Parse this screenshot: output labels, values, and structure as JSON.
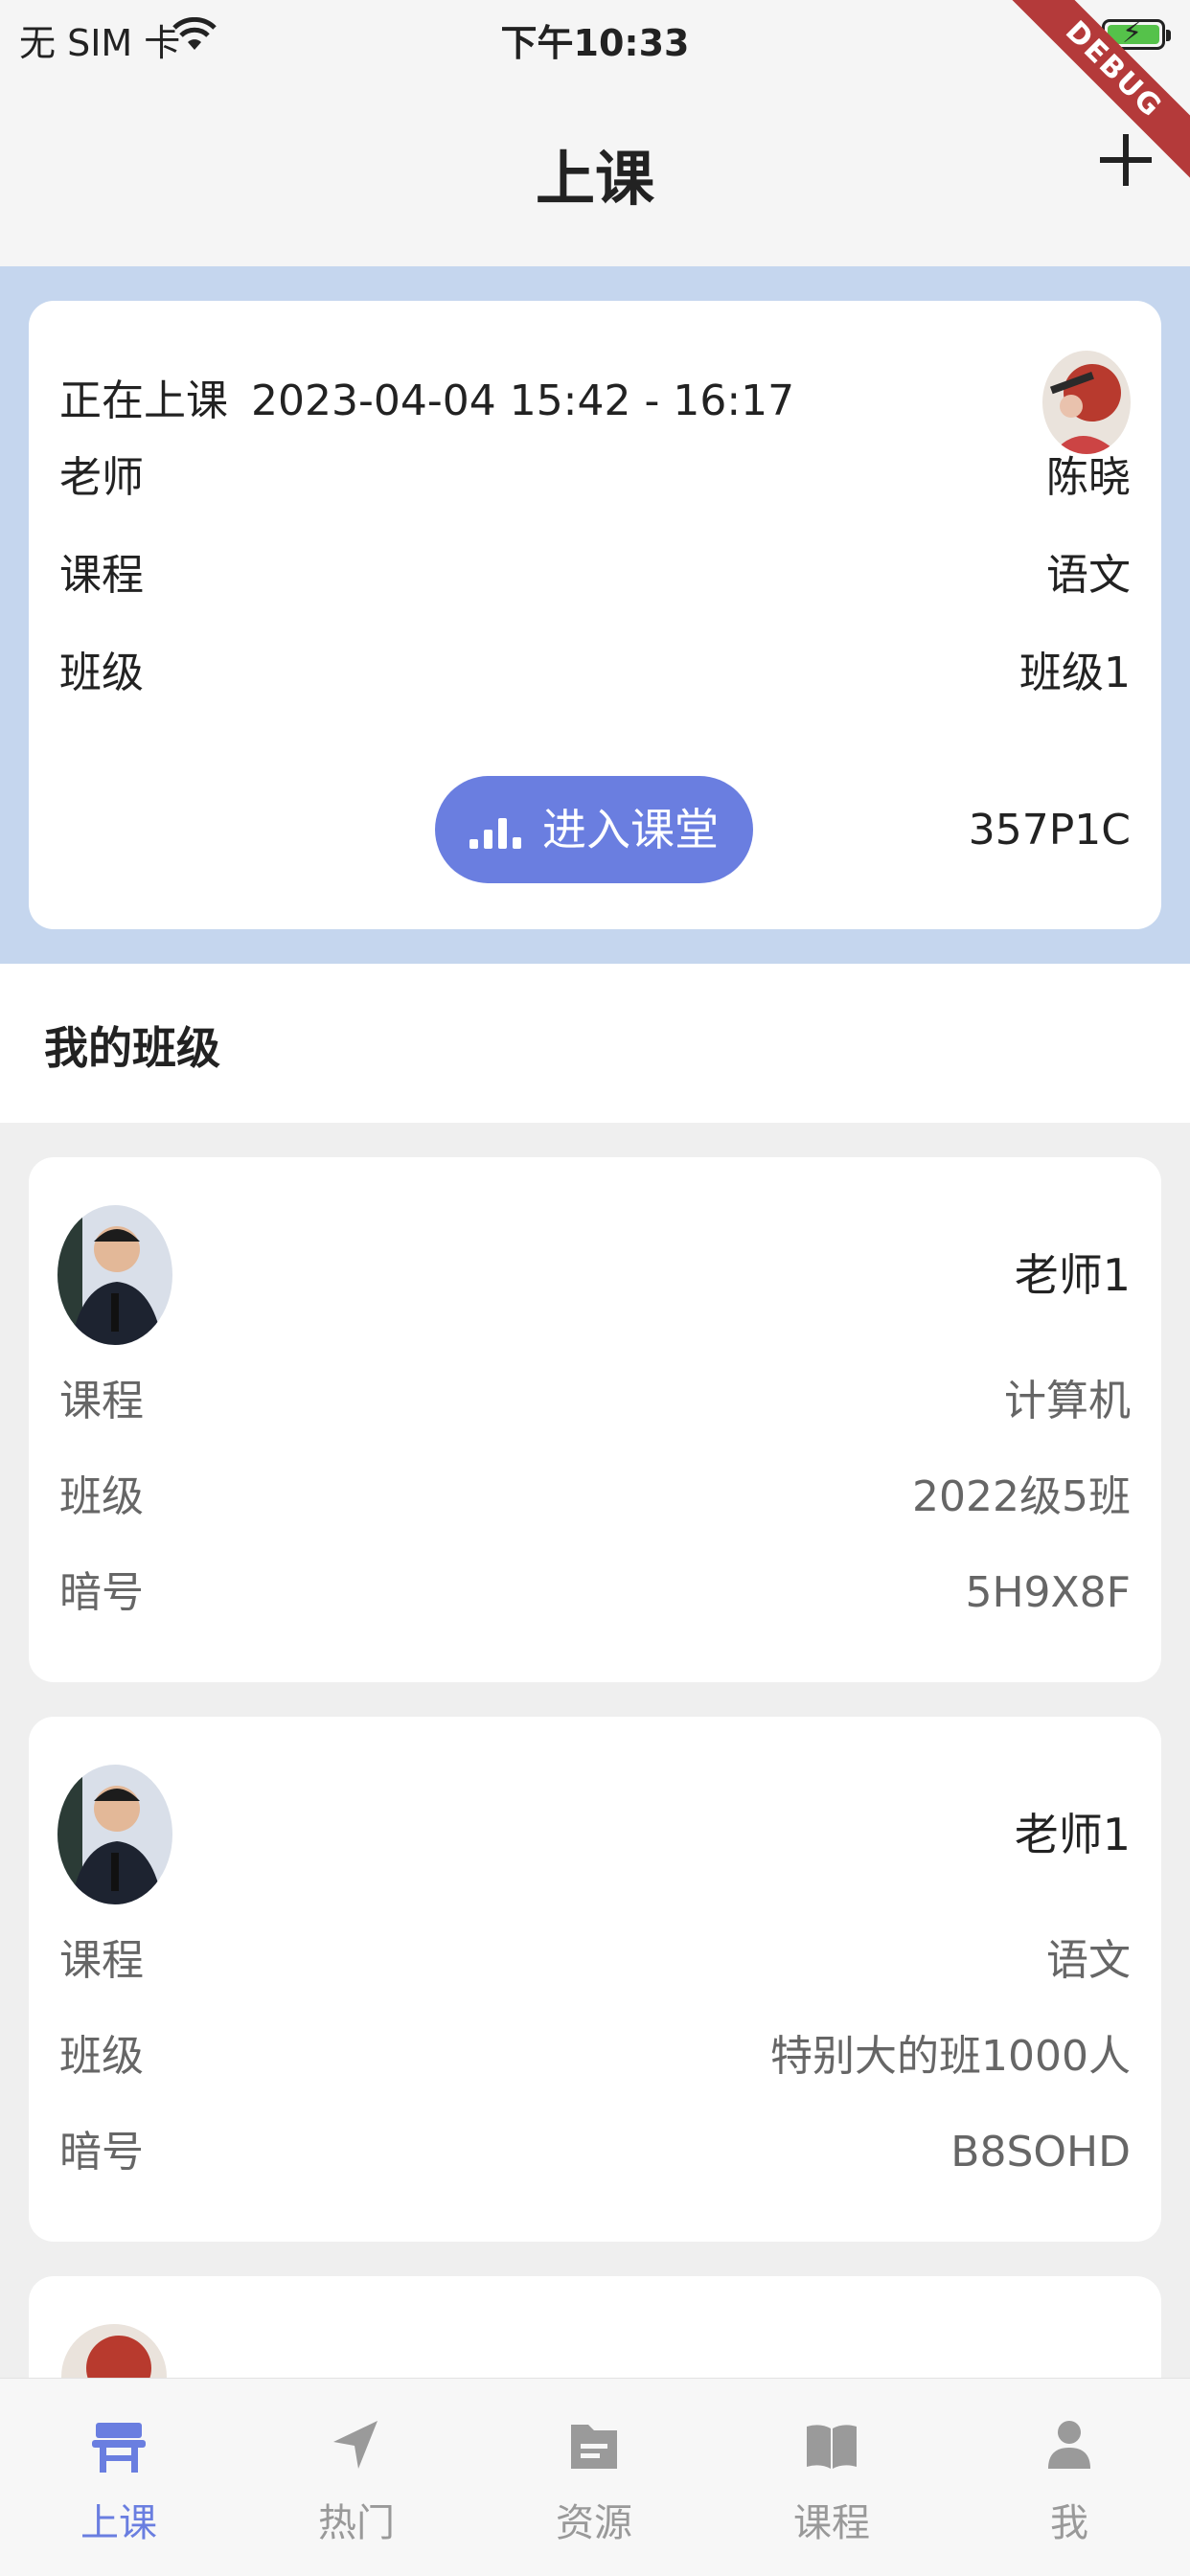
{
  "status_bar": {
    "carrier": "无 SIM 卡",
    "time": "下午10:33",
    "debug_banner": "DEBUG"
  },
  "header": {
    "title": "上课",
    "add_icon": "plus-icon"
  },
  "current_lesson": {
    "status": "正在上课",
    "time_range": "2023-04-04 15:42 - 16:17",
    "teacher_label": "老师",
    "teacher": "陈晓",
    "course_label": "课程",
    "course": "语文",
    "class_label": "班级",
    "class": "班级1",
    "enter_button": "进入课堂",
    "code": "357P1C"
  },
  "my_classes": {
    "title": "我的班级",
    "items": [
      {
        "teacher": "老师1",
        "course_label": "课程",
        "course": "计算机",
        "class_label": "班级",
        "class": "2022级5班",
        "code_label": "暗号",
        "code": "5H9X8F"
      },
      {
        "teacher": "老师1",
        "course_label": "课程",
        "course": "语文",
        "class_label": "班级",
        "class": "特别大的班1000人",
        "code_label": "暗号",
        "code": "B8SOHD"
      }
    ]
  },
  "tabbar": {
    "active_color": "#6a7ee0",
    "items": [
      {
        "label": "上课",
        "icon": "desk-icon",
        "active": true
      },
      {
        "label": "热门",
        "icon": "navigation-arrow-icon",
        "active": false
      },
      {
        "label": "资源",
        "icon": "folder-icon",
        "active": false
      },
      {
        "label": "课程",
        "icon": "book-icon",
        "active": false
      },
      {
        "label": "我",
        "icon": "person-icon",
        "active": false
      }
    ]
  }
}
